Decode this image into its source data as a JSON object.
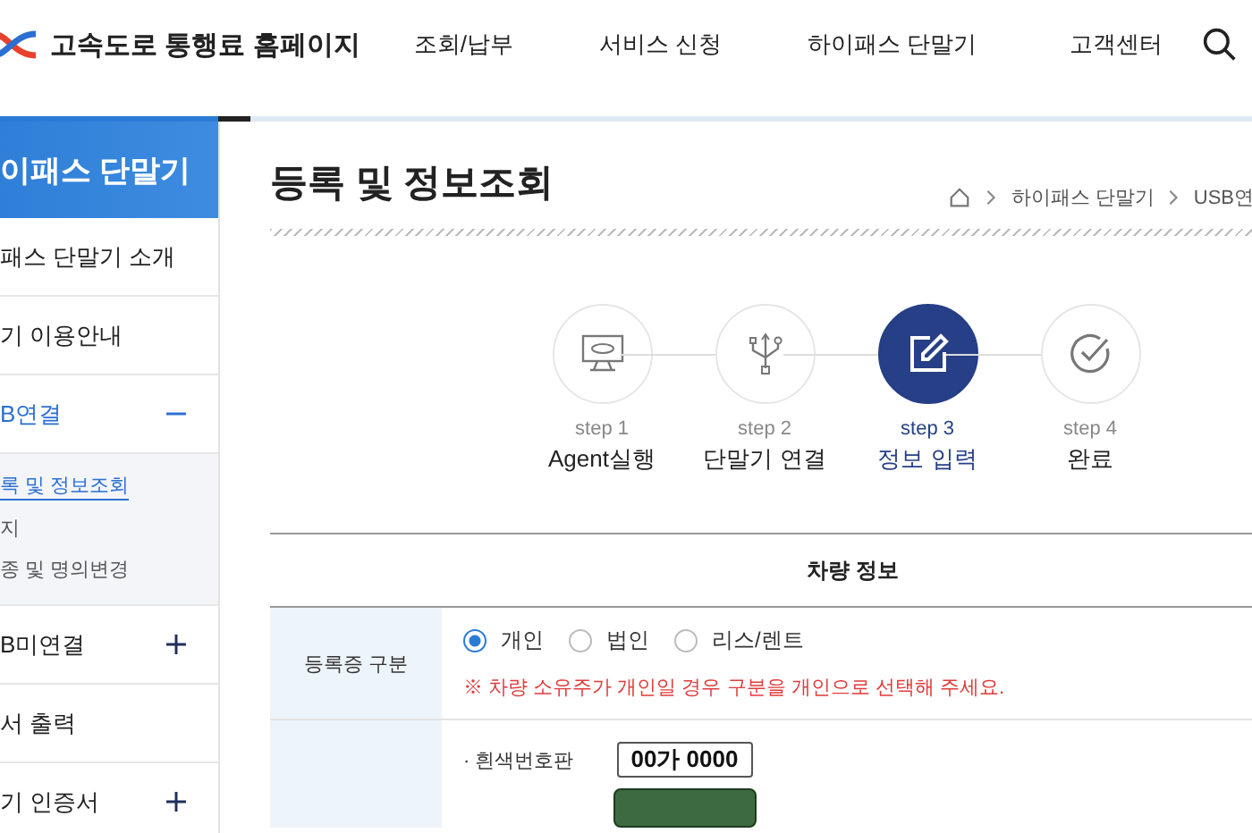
{
  "header": {
    "site_title": "고속도로 통행료 홈페이지",
    "nav": [
      "조회/납부",
      "서비스 신청",
      "하이패스 단말기",
      "고객센터"
    ]
  },
  "sidebar": {
    "title": "이패스 단말기",
    "items": [
      {
        "label": "패스 단말기 소개",
        "expanded": false,
        "kind": "plain"
      },
      {
        "label": "기 이용안내",
        "expanded": false,
        "kind": "plain"
      },
      {
        "label": "B연결",
        "expanded": true,
        "kind": "collapsible",
        "children": [
          {
            "label": "록 및 정보조회",
            "selected": true
          },
          {
            "label": "지",
            "selected": false
          },
          {
            "label": "종 및 명의변경",
            "selected": false
          }
        ]
      },
      {
        "label": "B미연결",
        "expanded": false,
        "kind": "collapsible"
      },
      {
        "label": "서 출력",
        "expanded": false,
        "kind": "plain"
      },
      {
        "label": "기 인증서",
        "expanded": false,
        "kind": "collapsible"
      }
    ]
  },
  "page_title": "등록 및 정보조회",
  "breadcrumb": [
    "하이패스 단말기",
    "USB연"
  ],
  "steps": [
    {
      "step": "step 1",
      "label": "Agent실행",
      "selected": false,
      "kind": "monitor"
    },
    {
      "step": "step 2",
      "label": "단말기 연결",
      "selected": false,
      "kind": "usb"
    },
    {
      "step": "step 3",
      "label": "정보 입력",
      "selected": true,
      "kind": "edit"
    },
    {
      "step": "step 4",
      "label": "완료",
      "selected": false,
      "kind": "check"
    }
  ],
  "table": {
    "heading": "차량 정보",
    "registration": {
      "label": "등록증 구분",
      "options": [
        {
          "label": "개인",
          "selected": true
        },
        {
          "label": "법인",
          "selected": false
        },
        {
          "label": "리스/렌트",
          "selected": false
        }
      ],
      "note": "※ 차량 소유주가 개인일 경우 구분을 개인으로 선택해 주세요."
    },
    "plate": {
      "label": "· 흰색번호판",
      "value": "00가 0000"
    }
  }
}
